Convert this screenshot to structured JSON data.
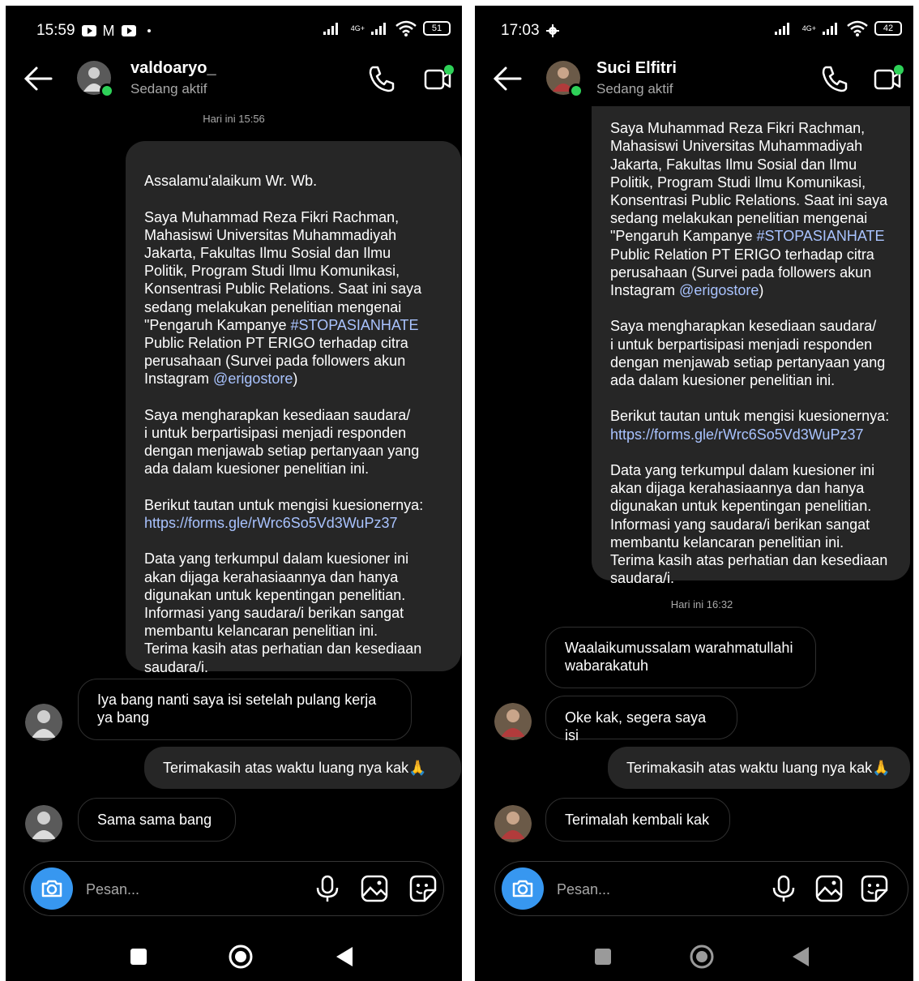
{
  "left": {
    "status": {
      "time": "15:59",
      "net": "4G+",
      "battery": "51"
    },
    "header": {
      "name": "valdoaryo_",
      "status": "Sedang aktif"
    },
    "timestamp": "Hari ini 15:56",
    "msg_main": {
      "p1": "Assalamu'alaikum Wr. Wb.",
      "p2a": "Saya Muhammad Reza Fikri Rachman,\nMahasiswi Universitas Muhammadiyah\nJakarta, Fakultas Ilmu Sosial dan Ilmu\nPolitik, Program Studi Ilmu Komunikasi,\nKonsentrasi Public Relations. Saat ini saya\nsedang melakukan penelitian mengenai\n\"Pengaruh Kampanye ",
      "hashtag": "#STOPASIANHATE",
      "p2b": "\nPublic Relation PT ERIGO terhadap citra\nperusahaan (Survei pada followers akun\nInstagram ",
      "mention": "@erigostore",
      "p2c": ")",
      "p3": "Saya mengharapkan kesediaan saudara/\ni untuk berpartisipasi menjadi responden\ndengan menjawab setiap pertanyaan yang\nada dalam kuesioner penelitian ini.",
      "p4": "Berikut tautan untuk mengisi kuesionernya:",
      "link": "https://forms.gle/rWrc6So5Vd3WuPz37",
      "p5": "Data yang terkumpul dalam kuesioner ini\nakan dijaga kerahasiaannya dan hanya\ndigunakan untuk kepentingan penelitian.\nInformasi yang saudara/i berikan sangat\nmembantu kelancaran penelitian ini.\nTerima kasih atas perhatian dan kesediaan\nsaudara/i."
    },
    "msg_reply1": "Iya bang nanti saya isi setelah pulang kerja\nya bang",
    "msg_thanks": "Terimakasih atas waktu luang nya kak🙏",
    "msg_reply2": "Sama sama bang",
    "composer": {
      "placeholder": "Pesan..."
    }
  },
  "right": {
    "status": {
      "time": "17:03",
      "net": "4G+",
      "battery": "42"
    },
    "header": {
      "name": "Suci Elfitri",
      "status": "Sedang aktif"
    },
    "msg_main": {
      "p2a": "Saya Muhammad Reza Fikri Rachman,\nMahasiswi Universitas Muhammadiyah\nJakarta, Fakultas Ilmu Sosial dan Ilmu\nPolitik, Program Studi Ilmu Komunikasi,\nKonsentrasi Public Relations. Saat ini saya\nsedang melakukan penelitian mengenai\n\"Pengaruh Kampanye ",
      "hashtag": "#STOPASIANHATE",
      "p2b": "\nPublic Relation PT ERIGO terhadap citra\nperusahaan (Survei pada followers akun\nInstagram ",
      "mention": "@erigostore",
      "p2c": ")",
      "p3": "Saya mengharapkan kesediaan saudara/\ni untuk berpartisipasi menjadi responden\ndengan menjawab setiap pertanyaan yang\nada dalam kuesioner penelitian ini.",
      "p4": "Berikut tautan untuk mengisi kuesionernya:",
      "link": "https://forms.gle/rWrc6So5Vd3WuPz37",
      "p5": "Data yang terkumpul dalam kuesioner ini\nakan dijaga kerahasiaannya dan hanya\ndigunakan untuk kepentingan penelitian.\nInformasi yang saudara/i berikan sangat\nmembantu kelancaran penelitian ini.\nTerima kasih atas perhatian dan kesediaan\nsaudara/i."
    },
    "timestamp": "Hari ini 16:32",
    "msg_reply1": "Waalaikumussalam warahmatullahi\nwabarakatuh",
    "msg_reply2": "Oke kak, segera saya isi",
    "msg_thanks": "Terimakasih atas waktu luang nya kak🙏",
    "msg_reply3": "Terimalah kembali kak",
    "composer": {
      "placeholder": "Pesan..."
    }
  },
  "colors": {
    "bubble_out": "#262626",
    "link": "#a9c3ff",
    "accent": "#3797f0",
    "active": "#2ed158"
  }
}
